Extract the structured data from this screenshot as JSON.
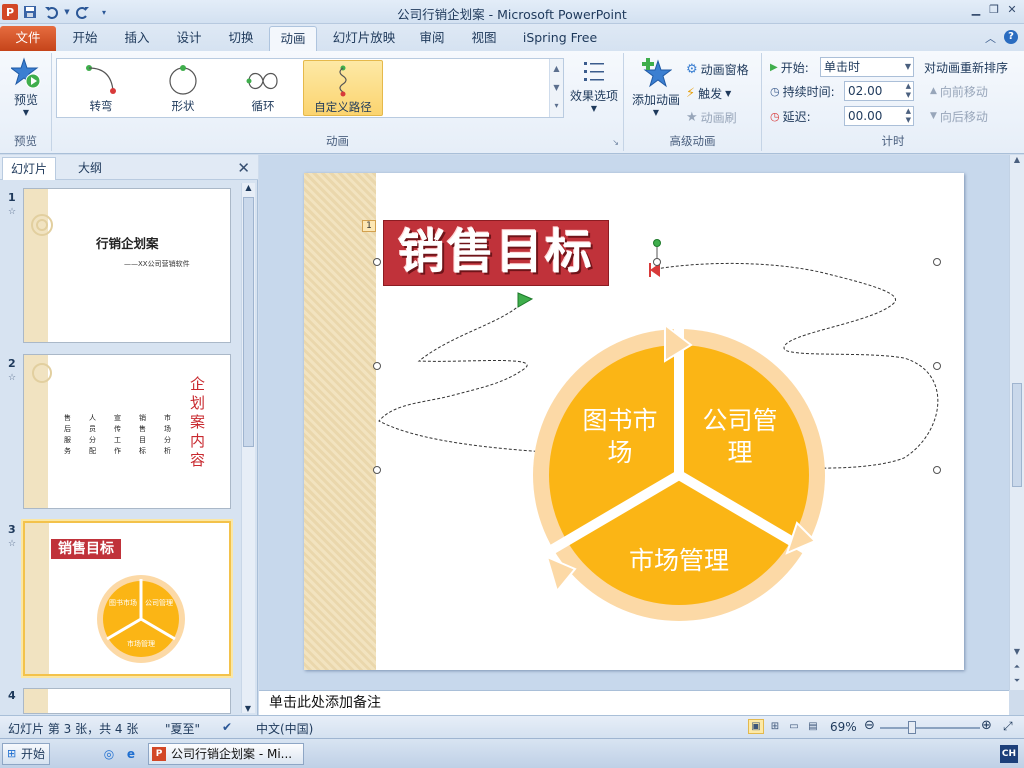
{
  "window": {
    "title": "公司行销企划案 - Microsoft PowerPoint",
    "qat_icons": [
      "powerpoint-logo-icon",
      "save-icon",
      "undo-icon",
      "redo-icon",
      "customize-qat-icon"
    ],
    "controls": [
      "minimize-icon",
      "restore-icon",
      "close-icon"
    ]
  },
  "tabs": [
    "文件",
    "开始",
    "插入",
    "设计",
    "切换",
    "动画",
    "幻灯片放映",
    "审阅",
    "视图",
    "iSpring Free"
  ],
  "active_tab": "动画",
  "ribbon": {
    "preview": {
      "label": "预览",
      "group": "预览"
    },
    "animation_gallery": {
      "items": [
        "转弯",
        "形状",
        "循环",
        "自定义路径"
      ],
      "selected": "自定义路径",
      "group": "动画"
    },
    "effect_options": "效果选项",
    "advanced": {
      "add_animation": "添加动画",
      "animation_pane": "动画窗格",
      "trigger": "触发",
      "animation_painter": "动画刷",
      "group": "高级动画"
    },
    "timing": {
      "start_label": "开始:",
      "start_value": "单击时",
      "duration_label": "持续时间:",
      "duration_value": "02.00",
      "delay_label": "延迟:",
      "delay_value": "00.00",
      "reorder_label": "对动画重新排序",
      "move_earlier": "向前移动",
      "move_later": "向后移动",
      "group": "计时"
    }
  },
  "left_pane": {
    "tabs": [
      "幻灯片",
      "大纲"
    ],
    "active": "幻灯片",
    "slides": [
      {
        "num": "1",
        "title": "行销企划案",
        "subtitle": "——XX公司营销软件"
      },
      {
        "num": "2",
        "heading": "企划案内容",
        "columns": [
          "售后服务",
          "人员分配",
          "宣传工作",
          "销售目标",
          "市场分析"
        ]
      },
      {
        "num": "3",
        "title": "销售目标",
        "segments": [
          "图书市场",
          "公司管理",
          "市场管理"
        ]
      },
      {
        "num": "4"
      }
    ]
  },
  "slide": {
    "title": "销售目标",
    "anim_marker": "1",
    "cycle": {
      "segments": [
        "图书市场",
        "公司管理",
        "市场管理"
      ],
      "fill_color": "#fbb515",
      "arrow_color": "#fcd9a6"
    }
  },
  "notes_placeholder": "单击此处添加备注",
  "status": {
    "slide_info": "幻灯片 第 3 张，共 4 张",
    "theme": "\"夏至\"",
    "language": "中文(中国)",
    "zoom": "69%"
  },
  "taskbar": {
    "start": "开始",
    "active_item": "公司行销企划案 - Mi...",
    "ime": "CH"
  },
  "colors": {
    "file_tab": "#d24726",
    "title_fill": "#c0323a",
    "selected_gallery": "#fbd470"
  }
}
